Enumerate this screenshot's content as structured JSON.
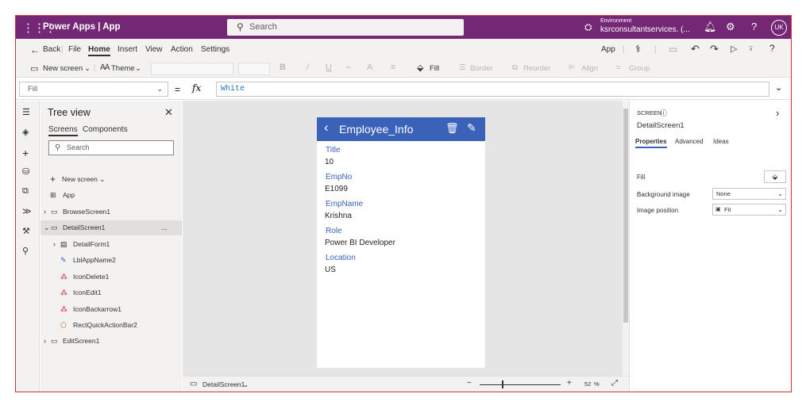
{
  "appbar": {
    "title": "Power Apps  |  App",
    "search_placeholder": "Search",
    "environment_label": "Environment",
    "environment_value": "ksrconsultantservices. (...",
    "avatar": "UK"
  },
  "menu": {
    "back": "Back",
    "items": [
      "File",
      "Home",
      "Insert",
      "View",
      "Action",
      "Settings"
    ],
    "right_label": "App"
  },
  "toolbar": {
    "new_screen": "New screen",
    "theme": "Theme",
    "fill": "Fill",
    "border": "Border",
    "reorder": "Reorder",
    "align": "Align",
    "group": "Group"
  },
  "formula_bar": {
    "property": "Fill",
    "equals": "=",
    "fx": "fx",
    "formula": "White"
  },
  "tree": {
    "header": "Tree view",
    "tabs": [
      "Screens",
      "Components"
    ],
    "search_placeholder": "Search",
    "new_screen": "New screen",
    "app": "App",
    "items": [
      "BrowseScreen1",
      "DetailScreen1",
      "DetailForm1",
      "LblAppName2",
      "IconDelete1",
      "IconEdit1",
      "IconBackarrow1",
      "RectQuickActionBar2",
      "EditScreen1"
    ],
    "more": "..."
  },
  "screen": {
    "header": "Employee_Info",
    "fields": [
      {
        "label": "Title",
        "value": "10"
      },
      {
        "label": "EmpNo",
        "value": "E1099"
      },
      {
        "label": "EmpName",
        "value": "Krishna"
      },
      {
        "label": "Role",
        "value": "Power BI Developer"
      },
      {
        "label": "Location",
        "value": "US"
      }
    ]
  },
  "status": {
    "screen": "DetailScreen1",
    "zoom_minus": "−",
    "zoom_plus": "+",
    "zoom": "52",
    "zoom_unit": "%"
  },
  "panel": {
    "kind": "SCREEN",
    "name": "DetailScreen1",
    "tabs": [
      "Properties",
      "Advanced",
      "Ideas"
    ],
    "fill_label": "Fill",
    "bg_image_label": "Background image",
    "bg_image_value": "None",
    "img_pos_label": "Image position",
    "img_pos_value": "Fit"
  },
  "colors": {
    "appbar": "#742774",
    "screen_header": "#3b62b9",
    "selection_border": "#d13438"
  }
}
